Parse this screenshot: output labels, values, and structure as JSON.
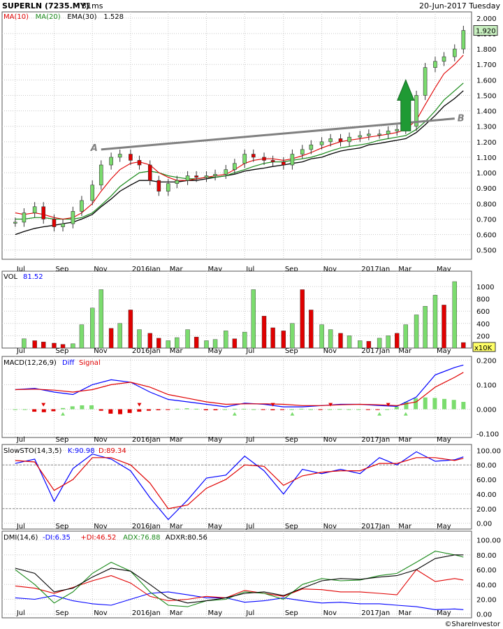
{
  "header": {
    "symbol": "SUPERLN (7235.MY)",
    "elapsed": "31ms",
    "date": "20-Jun-2017 Tuesday"
  },
  "colors": {
    "up": "#7bdc6e",
    "down": "#e00000",
    "ma10": "#e00000",
    "ma20": "#1a8a1a",
    "ema30": "#000000",
    "diff": "#0000ff",
    "signal": "#e00000",
    "k": "#0000ff",
    "d": "#e00000",
    "minus_di": "#0000ff",
    "plus_di": "#e00000",
    "adx": "#1a8a1a",
    "adxr": "#000000",
    "trendline": "#808080",
    "arrow": "#1f9a34"
  },
  "x_axis_labels": [
    "Jul",
    "Sep",
    "Nov",
    "2016Jan",
    "Mar",
    "May",
    "Jul",
    "Sep",
    "Nov",
    "2017Jan",
    "Mar",
    "May"
  ],
  "footer": "©ShareInvestor",
  "chart_data": [
    {
      "type": "candlestick",
      "legend": [
        {
          "key": "ma10",
          "label": "MA(10)"
        },
        {
          "key": "ma20",
          "label": "MA(20)"
        },
        {
          "key": "ema30",
          "label": "EMA(30)"
        }
      ],
      "legend_value": "1.528",
      "last_price": "1.920",
      "ylim": [
        0.44,
        2.04
      ],
      "y_ticks": [
        0.5,
        0.6,
        0.7,
        0.8,
        0.9,
        1.0,
        1.1,
        1.2,
        1.3,
        1.4,
        1.5,
        1.6,
        1.7,
        1.8,
        1.9,
        2.0
      ],
      "y_tick_labels": [
        "0.500",
        "0.600",
        "0.700",
        "0.800",
        "0.900",
        "1.000",
        "1.100",
        "1.200",
        "1.300",
        "1.400",
        "1.500",
        "1.600",
        "1.700",
        "1.800",
        "1.900",
        "2.000"
      ],
      "x": [
        "2015-07-01",
        "2015-07-15",
        "2015-08-01",
        "2015-08-15",
        "2015-09-01",
        "2015-09-15",
        "2015-10-01",
        "2015-10-15",
        "2015-11-01",
        "2015-11-15",
        "2015-12-01",
        "2015-12-15",
        "2016-01-01",
        "2016-01-15",
        "2016-02-01",
        "2016-02-15",
        "2016-03-01",
        "2016-03-15",
        "2016-04-01",
        "2016-04-15",
        "2016-05-01",
        "2016-05-15",
        "2016-06-01",
        "2016-06-15",
        "2016-07-01",
        "2016-07-15",
        "2016-08-01",
        "2016-08-15",
        "2016-09-01",
        "2016-09-15",
        "2016-10-01",
        "2016-10-15",
        "2016-11-01",
        "2016-11-15",
        "2016-12-01",
        "2016-12-15",
        "2017-01-01",
        "2017-01-15",
        "2017-02-01",
        "2017-02-15",
        "2017-03-01",
        "2017-03-15",
        "2017-04-01",
        "2017-04-15",
        "2017-05-01",
        "2017-05-15",
        "2017-06-01",
        "2017-06-15"
      ],
      "close": [
        0.68,
        0.74,
        0.78,
        0.7,
        0.65,
        0.67,
        0.75,
        0.82,
        0.92,
        1.05,
        1.1,
        1.12,
        1.08,
        1.05,
        0.95,
        0.88,
        0.93,
        0.95,
        0.98,
        0.97,
        0.98,
        0.99,
        1.02,
        1.06,
        1.12,
        1.1,
        1.08,
        1.07,
        1.05,
        1.12,
        1.15,
        1.18,
        1.2,
        1.22,
        1.2,
        1.23,
        1.24,
        1.25,
        1.25,
        1.27,
        1.28,
        1.3,
        1.5,
        1.68,
        1.72,
        1.75,
        1.8,
        1.92
      ],
      "ma10": [
        0.74,
        0.73,
        0.74,
        0.73,
        0.71,
        0.7,
        0.71,
        0.74,
        0.8,
        0.88,
        0.96,
        1.02,
        1.06,
        1.07,
        1.05,
        1.0,
        0.97,
        0.95,
        0.95,
        0.96,
        0.97,
        0.98,
        0.99,
        1.02,
        1.06,
        1.08,
        1.09,
        1.09,
        1.08,
        1.09,
        1.11,
        1.13,
        1.16,
        1.18,
        1.2,
        1.21,
        1.22,
        1.23,
        1.24,
        1.25,
        1.26,
        1.28,
        1.34,
        1.44,
        1.55,
        1.64,
        1.7,
        1.76
      ],
      "ma20": [
        0.7,
        0.7,
        0.71,
        0.71,
        0.7,
        0.7,
        0.7,
        0.71,
        0.74,
        0.79,
        0.85,
        0.91,
        0.96,
        1.0,
        1.01,
        1.0,
        0.98,
        0.97,
        0.96,
        0.96,
        0.97,
        0.97,
        0.98,
        1.0,
        1.02,
        1.04,
        1.06,
        1.07,
        1.07,
        1.08,
        1.09,
        1.1,
        1.12,
        1.14,
        1.16,
        1.17,
        1.18,
        1.19,
        1.21,
        1.22,
        1.23,
        1.24,
        1.28,
        1.33,
        1.4,
        1.47,
        1.53,
        1.58
      ],
      "ema30": [
        0.6,
        0.62,
        0.64,
        0.65,
        0.66,
        0.67,
        0.68,
        0.7,
        0.73,
        0.78,
        0.83,
        0.88,
        0.92,
        0.95,
        0.95,
        0.94,
        0.94,
        0.94,
        0.95,
        0.95,
        0.96,
        0.97,
        0.98,
        0.99,
        1.01,
        1.02,
        1.03,
        1.04,
        1.05,
        1.06,
        1.07,
        1.09,
        1.1,
        1.12,
        1.14,
        1.15,
        1.16,
        1.18,
        1.19,
        1.2,
        1.21,
        1.22,
        1.26,
        1.31,
        1.37,
        1.43,
        1.48,
        1.53
      ],
      "trendline": {
        "points": [
          [
            "2015-11-15",
            1.15
          ],
          [
            "2017-06-01",
            1.35
          ]
        ],
        "label_start": "A",
        "label_end": "B"
      },
      "arrow": {
        "x": "2017-03-15",
        "y_from": 1.27,
        "y_to": 1.6
      }
    },
    {
      "type": "bar",
      "name": "VOL",
      "legend_value": "81.52",
      "unit_badge": "x10K",
      "ylim": [
        0,
        1250
      ],
      "y_ticks": [
        200,
        400,
        600,
        800,
        1000
      ],
      "y_tick_labels": [
        "200",
        "400",
        "600",
        "800",
        "1000"
      ],
      "x": [
        "2015-07-15",
        "2015-08-01",
        "2015-08-15",
        "2015-09-01",
        "2015-09-15",
        "2015-10-01",
        "2015-10-15",
        "2015-11-01",
        "2015-11-15",
        "2015-12-01",
        "2015-12-15",
        "2016-01-01",
        "2016-01-15",
        "2016-02-01",
        "2016-02-15",
        "2016-03-01",
        "2016-03-15",
        "2016-04-01",
        "2016-04-15",
        "2016-05-01",
        "2016-05-15",
        "2016-06-01",
        "2016-06-15",
        "2016-07-01",
        "2016-07-15",
        "2016-08-01",
        "2016-08-15",
        "2016-09-01",
        "2016-09-15",
        "2016-10-01",
        "2016-10-15",
        "2016-11-01",
        "2016-11-15",
        "2016-12-01",
        "2016-12-15",
        "2017-01-01",
        "2017-01-15",
        "2017-02-01",
        "2017-02-15",
        "2017-03-01",
        "2017-03-15",
        "2017-04-01",
        "2017-04-15",
        "2017-05-01",
        "2017-05-15",
        "2017-06-01",
        "2017-06-15"
      ],
      "values": [
        150,
        120,
        100,
        80,
        60,
        70,
        380,
        650,
        950,
        320,
        400,
        620,
        300,
        240,
        160,
        120,
        170,
        300,
        180,
        120,
        140,
        280,
        150,
        260,
        950,
        520,
        330,
        280,
        400,
        950,
        620,
        380,
        300,
        240,
        200,
        120,
        110,
        160,
        200,
        240,
        380,
        540,
        680,
        860,
        700,
        1080,
        90
      ],
      "direction": [
        "up",
        "down",
        "down",
        "down",
        "down",
        "up",
        "up",
        "up",
        "up",
        "down",
        "up",
        "down",
        "up",
        "down",
        "down",
        "up",
        "up",
        "up",
        "down",
        "up",
        "up",
        "up",
        "down",
        "up",
        "up",
        "down",
        "down",
        "down",
        "up",
        "down",
        "down",
        "up",
        "up",
        "down",
        "up",
        "up",
        "down",
        "up",
        "up",
        "down",
        "up",
        "up",
        "up",
        "up",
        "down",
        "up",
        "down"
      ]
    },
    {
      "type": "line",
      "name": "MACD(12,26,9)",
      "legend": [
        {
          "key": "diff",
          "label": "Diff"
        },
        {
          "key": "signal",
          "label": "Signal"
        }
      ],
      "ylim": [
        -0.115,
        0.215
      ],
      "y_ticks": [
        -0.1,
        0.0,
        0.1,
        0.2
      ],
      "y_tick_labels": [
        "-0.100",
        "0.000",
        "0.100",
        "0.200"
      ],
      "x": [
        "2015-07-01",
        "2015-08-01",
        "2015-09-01",
        "2015-10-01",
        "2015-11-01",
        "2015-12-01",
        "2016-01-01",
        "2016-02-01",
        "2016-03-01",
        "2016-04-01",
        "2016-05-01",
        "2016-06-01",
        "2016-07-01",
        "2016-08-01",
        "2016-09-01",
        "2016-10-01",
        "2016-11-01",
        "2016-12-01",
        "2017-01-01",
        "2017-02-01",
        "2017-03-01",
        "2017-04-01",
        "2017-05-01",
        "2017-06-01",
        "2017-06-15"
      ],
      "series": [
        {
          "key": "diff",
          "values": [
            0.08,
            0.085,
            0.07,
            0.06,
            0.1,
            0.12,
            0.11,
            0.07,
            0.04,
            0.03,
            0.02,
            0.01,
            0.025,
            0.02,
            0.01,
            0.01,
            0.015,
            0.02,
            0.02,
            0.015,
            0.012,
            0.05,
            0.14,
            0.17,
            0.18
          ]
        },
        {
          "key": "signal",
          "values": [
            0.08,
            0.082,
            0.078,
            0.07,
            0.08,
            0.1,
            0.11,
            0.09,
            0.06,
            0.045,
            0.03,
            0.02,
            0.022,
            0.022,
            0.02,
            0.015,
            0.015,
            0.018,
            0.02,
            0.018,
            0.015,
            0.03,
            0.09,
            0.13,
            0.15
          ]
        }
      ],
      "hist": [
        0.0,
        0.0,
        -0.01,
        -0.012,
        -0.008,
        0.005,
        0.012,
        0.016,
        0.016,
        -0.006,
        -0.018,
        -0.02,
        -0.015,
        -0.01,
        -0.006,
        -0.004,
        -0.002,
        0.002,
        0.004,
        0.002,
        -0.004,
        -0.004,
        0.0,
        0.002,
        0.002,
        0.0,
        -0.002,
        -0.004,
        -0.003,
        0.0,
        0.002,
        0.0,
        -0.001,
        0.0,
        0.001,
        0.0,
        0.0,
        -0.001,
        -0.002,
        0.0,
        0.01,
        0.03,
        0.045,
        0.048,
        0.046,
        0.042,
        0.038,
        0.03
      ],
      "cross_up": [
        "2015-09-15",
        "2016-06-15",
        "2016-09-15",
        "2017-02-01",
        "2017-03-15"
      ],
      "cross_down": [
        "2015-08-15",
        "2016-01-15",
        "2016-08-15",
        "2016-11-15",
        "2017-02-15"
      ]
    },
    {
      "type": "line",
      "name": "SlowSTO(14,3,5)",
      "legend": [
        {
          "key": "k",
          "label": "K:90.98"
        },
        {
          "key": "d",
          "label": "D:89.34"
        }
      ],
      "ylim": [
        -8,
        108
      ],
      "y_ticks": [
        0,
        20,
        40,
        60,
        80,
        100
      ],
      "y_tick_labels": [
        "0.00",
        "20.00",
        "40.00",
        "60.00",
        "80.00",
        "100.00"
      ],
      "dashed_levels": [
        20,
        80
      ],
      "x": [
        "2015-07-01",
        "2015-08-01",
        "2015-09-01",
        "2015-10-01",
        "2015-11-01",
        "2015-12-01",
        "2016-01-01",
        "2016-02-01",
        "2016-03-01",
        "2016-04-01",
        "2016-05-01",
        "2016-06-01",
        "2016-07-01",
        "2016-08-01",
        "2016-09-01",
        "2016-10-01",
        "2016-11-01",
        "2016-12-01",
        "2017-01-01",
        "2017-02-01",
        "2017-03-01",
        "2017-04-01",
        "2017-05-01",
        "2017-06-01",
        "2017-06-15"
      ],
      "series": [
        {
          "key": "k",
          "values": [
            82,
            88,
            30,
            75,
            95,
            88,
            72,
            35,
            5,
            32,
            62,
            66,
            92,
            72,
            40,
            74,
            68,
            74,
            68,
            90,
            80,
            98,
            85,
            87,
            91
          ]
        },
        {
          "key": "d",
          "values": [
            86,
            84,
            45,
            60,
            90,
            90,
            80,
            55,
            20,
            25,
            48,
            60,
            80,
            78,
            52,
            65,
            70,
            72,
            72,
            82,
            82,
            90,
            90,
            86,
            89
          ]
        }
      ]
    },
    {
      "type": "line",
      "name": "DMI(14,6)",
      "legend": [
        {
          "key": "minus_di",
          "label": "-DI:6.35"
        },
        {
          "key": "plus_di",
          "label": "+DI:46.52"
        },
        {
          "key": "adx",
          "label": "ADX:76.88"
        },
        {
          "key": "adxr",
          "label": "ADXR:80.56"
        }
      ],
      "ylim": [
        -5,
        112
      ],
      "y_ticks": [
        0,
        20,
        40,
        60,
        80,
        100
      ],
      "y_tick_labels": [
        "0.00",
        "20.00",
        "40.00",
        "60.00",
        "80.00",
        "100.00"
      ],
      "x": [
        "2015-07-01",
        "2015-08-01",
        "2015-09-01",
        "2015-10-01",
        "2015-11-01",
        "2015-12-01",
        "2016-01-01",
        "2016-02-01",
        "2016-03-01",
        "2016-04-01",
        "2016-05-01",
        "2016-06-01",
        "2016-07-01",
        "2016-08-01",
        "2016-09-01",
        "2016-10-01",
        "2016-11-01",
        "2016-12-01",
        "2017-01-01",
        "2017-02-01",
        "2017-03-01",
        "2017-04-01",
        "2017-05-01",
        "2017-06-01",
        "2017-06-15"
      ],
      "series": [
        {
          "key": "minus_di",
          "values": [
            22,
            20,
            25,
            18,
            14,
            12,
            20,
            28,
            30,
            26,
            22,
            22,
            16,
            18,
            22,
            18,
            15,
            16,
            14,
            14,
            12,
            10,
            6,
            7,
            6
          ]
        },
        {
          "key": "plus_di",
          "values": [
            38,
            35,
            28,
            36,
            45,
            52,
            42,
            24,
            18,
            20,
            24,
            22,
            32,
            28,
            24,
            34,
            33,
            30,
            30,
            28,
            26,
            60,
            44,
            48,
            46
          ]
        },
        {
          "key": "adx",
          "values": [
            60,
            40,
            15,
            30,
            55,
            70,
            58,
            30,
            12,
            10,
            18,
            20,
            30,
            28,
            20,
            40,
            48,
            45,
            46,
            52,
            55,
            70,
            85,
            80,
            77
          ]
        },
        {
          "key": "adxr",
          "values": [
            62,
            55,
            30,
            35,
            50,
            62,
            58,
            40,
            22,
            15,
            18,
            22,
            28,
            30,
            25,
            35,
            45,
            48,
            47,
            50,
            52,
            60,
            75,
            80,
            80
          ]
        }
      ]
    }
  ]
}
